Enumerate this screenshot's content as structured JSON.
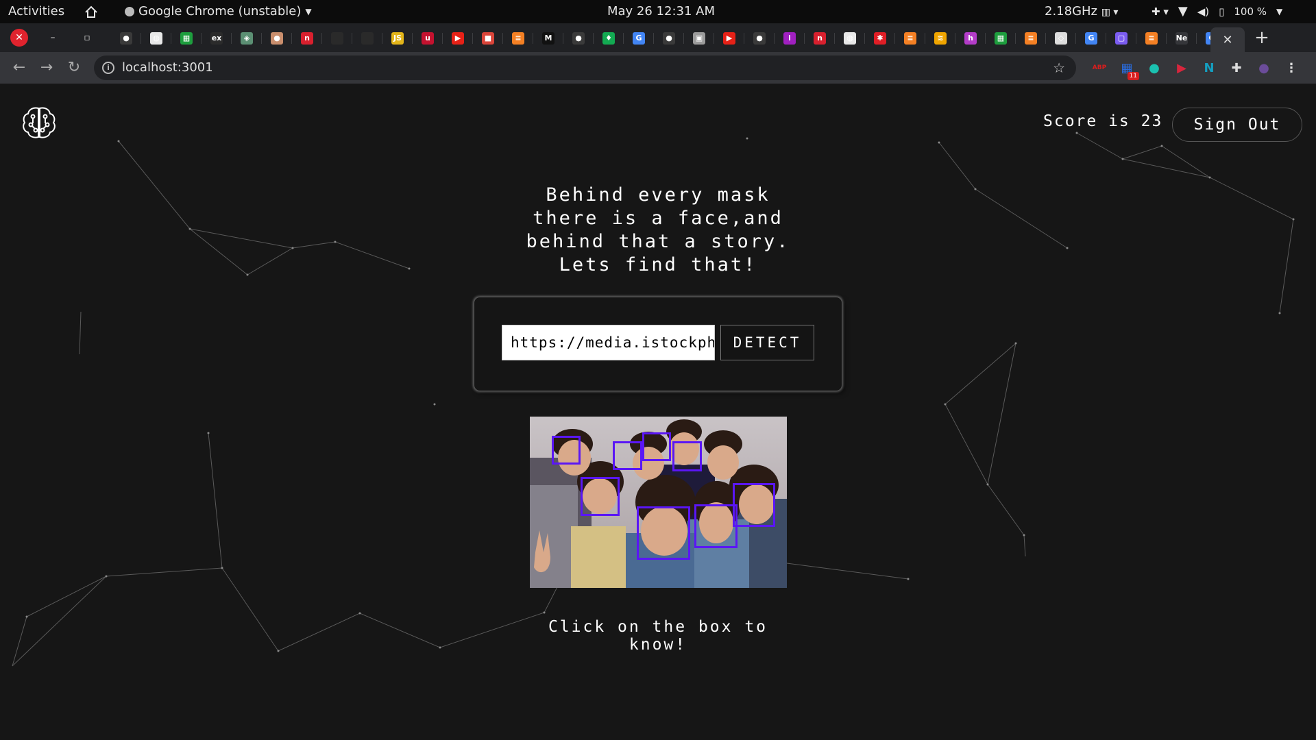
{
  "system_bar": {
    "activities": "Activities",
    "app_name": "Google Chrome (unstable)",
    "clock": "May 26  12:31 AM",
    "cpu": "2.18GHz",
    "battery": "100 %"
  },
  "browser": {
    "url": "localhost:3001",
    "active_tab_close": "✕",
    "new_tab": "+",
    "tabs": [
      {
        "icon": "github-icon",
        "glyph": "●",
        "color": "#3a3a3a"
      },
      {
        "icon": "globe-icon",
        "glyph": "◍",
        "color": "#e8e8e8"
      },
      {
        "icon": "sheet-icon",
        "glyph": "▦",
        "color": "#1e9e3e"
      },
      {
        "icon": "ex-icon",
        "glyph": "ex",
        "color": "#2b2b2b"
      },
      {
        "icon": "diamond-icon",
        "glyph": "◈",
        "color": "#5b8f73"
      },
      {
        "icon": "avatar-icon",
        "glyph": "●",
        "color": "#c98e6d"
      },
      {
        "icon": "n-red-icon",
        "glyph": "n",
        "color": "#d8202e"
      },
      {
        "icon": "blank-icon",
        "glyph": "",
        "color": "#2a2a2a"
      },
      {
        "icon": "blank-icon",
        "glyph": "",
        "color": "#2a2a2a"
      },
      {
        "icon": "js-icon",
        "glyph": "JS",
        "color": "#e3b51a"
      },
      {
        "icon": "u-icon",
        "glyph": "u",
        "color": "#c4122f"
      },
      {
        "icon": "youtube-icon",
        "glyph": "▶",
        "color": "#e62117"
      },
      {
        "icon": "box-icon",
        "glyph": "■",
        "color": "#d9453a"
      },
      {
        "icon": "stackoverflow-icon",
        "glyph": "≡",
        "color": "#f48024"
      },
      {
        "icon": "medium-icon",
        "glyph": "M",
        "color": "#111111"
      },
      {
        "icon": "github-icon",
        "glyph": "●",
        "color": "#3a3a3a"
      },
      {
        "icon": "leaf-icon",
        "glyph": "♦",
        "color": "#13aa52"
      },
      {
        "icon": "google-icon",
        "glyph": "G",
        "color": "#4285f4"
      },
      {
        "icon": "github-icon",
        "glyph": "●",
        "color": "#3a3a3a"
      },
      {
        "icon": "photo-icon",
        "glyph": "▣",
        "color": "#9b9b9b"
      },
      {
        "icon": "youtube-icon",
        "glyph": "▶",
        "color": "#e62117"
      },
      {
        "icon": "github-icon",
        "glyph": "●",
        "color": "#3a3a3a"
      },
      {
        "icon": "info-icon",
        "glyph": "i",
        "color": "#a020c0"
      },
      {
        "icon": "n-red-icon",
        "glyph": "n",
        "color": "#d8202e"
      },
      {
        "icon": "globe-icon",
        "glyph": "◍",
        "color": "#e8e8e8"
      },
      {
        "icon": "gear-red-icon",
        "glyph": "✱",
        "color": "#e01e26"
      },
      {
        "icon": "stackoverflow-icon",
        "glyph": "≡",
        "color": "#f48024"
      },
      {
        "icon": "bolt-icon",
        "glyph": "≋",
        "color": "#f0a500"
      },
      {
        "icon": "h-icon",
        "glyph": "h",
        "color": "#b33cc8"
      },
      {
        "icon": "sheet-icon",
        "glyph": "▦",
        "color": "#1e9e3e"
      },
      {
        "icon": "stackoverflow-icon",
        "glyph": "≡",
        "color": "#f48024"
      },
      {
        "icon": "codepen-icon",
        "glyph": "◇",
        "color": "#dddddd"
      },
      {
        "icon": "google-icon",
        "glyph": "G",
        "color": "#4285f4"
      },
      {
        "icon": "chat-icon",
        "glyph": "▢",
        "color": "#7b5cf0"
      },
      {
        "icon": "stackoverflow-icon",
        "glyph": "≡",
        "color": "#f48024"
      },
      {
        "icon": "ne-icon",
        "glyph": "Ne",
        "color": "#35363a"
      },
      {
        "icon": "google-icon",
        "glyph": "G",
        "color": "#4285f4"
      }
    ],
    "extensions": [
      {
        "icon": "adblock-icon",
        "glyph": "ABP",
        "color": "#d81e1e"
      },
      {
        "icon": "grid-extension-icon",
        "glyph": "▦",
        "color": "#2a6de0",
        "badge": "11"
      },
      {
        "icon": "circle-extension-icon",
        "glyph": "●",
        "color": "#1bc1b0"
      },
      {
        "icon": "video-extension-icon",
        "glyph": "▶",
        "color": "#d7263d"
      },
      {
        "icon": "n-extension-icon",
        "glyph": "N",
        "color": "#159fc0"
      },
      {
        "icon": "puzzle-icon",
        "glyph": "✚",
        "color": "#dddddd"
      },
      {
        "icon": "profile-avatar-icon",
        "glyph": "●",
        "color": "#6b4c9a"
      },
      {
        "icon": "kebab-menu-icon",
        "glyph": "⋮",
        "color": "#dddddd"
      }
    ]
  },
  "app": {
    "score_text": "Score is 23",
    "sign_out": "Sign Out",
    "headline": [
      "Behind every mask",
      "there is a face,and",
      "behind that a story.",
      "Lets find that!"
    ],
    "url_value": "https://media.istockphoto.com/photos/group-of-friends-taking-selfie",
    "detect_button": "DETECT",
    "hint": "Click on the box to know!",
    "face_count": 9,
    "accent_color": "#5a16f5"
  }
}
